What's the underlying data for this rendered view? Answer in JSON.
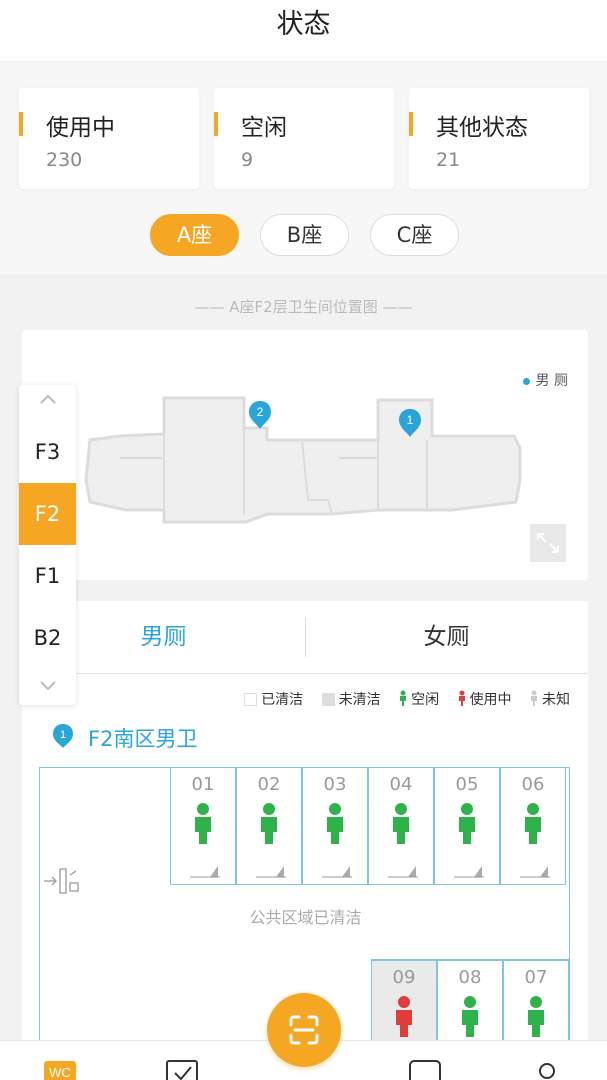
{
  "header": {
    "title": "状态"
  },
  "stats": [
    {
      "label": "使用中",
      "value": "230"
    },
    {
      "label": "空闲",
      "value": "9"
    },
    {
      "label": "其他状态",
      "value": "21"
    }
  ],
  "buildings": [
    {
      "label": "A座",
      "active": true
    },
    {
      "label": "B座",
      "active": false
    },
    {
      "label": "C座",
      "active": false
    }
  ],
  "map": {
    "caption": "A座F2层卫生间位置图",
    "legend": "男 厕",
    "markers": [
      "2",
      "1"
    ]
  },
  "floors": [
    {
      "label": "F3",
      "active": false
    },
    {
      "label": "F2",
      "active": true
    },
    {
      "label": "F1",
      "active": false
    },
    {
      "label": "B2",
      "active": false
    }
  ],
  "tabs": {
    "male": "男厕",
    "female": "女厕"
  },
  "legend": {
    "cleaned": "已清洁",
    "not_cleaned": "未清洁",
    "free": "空闲",
    "in_use": "使用中",
    "unknown": "未知"
  },
  "zone": {
    "marker": "1",
    "title": "F2南区男卫"
  },
  "stalls_top": [
    {
      "num": "01",
      "status": "free"
    },
    {
      "num": "02",
      "status": "free"
    },
    {
      "num": "03",
      "status": "free"
    },
    {
      "num": "04",
      "status": "free"
    },
    {
      "num": "05",
      "status": "free"
    },
    {
      "num": "06",
      "status": "free"
    }
  ],
  "public_area": "公共区域已清洁",
  "stalls_bottom": [
    {
      "num": "09",
      "status": "in_use",
      "cleaned": false
    },
    {
      "num": "08",
      "status": "free",
      "cleaned": true
    },
    {
      "num": "07",
      "status": "free",
      "cleaned": true
    }
  ],
  "colors": {
    "accent": "#f5a623",
    "blue": "#29a5d8",
    "free": "#2eb34a",
    "in_use": "#e23b3b",
    "unknown": "#cccccc"
  },
  "nav": {
    "first_icon_text": "WC"
  }
}
